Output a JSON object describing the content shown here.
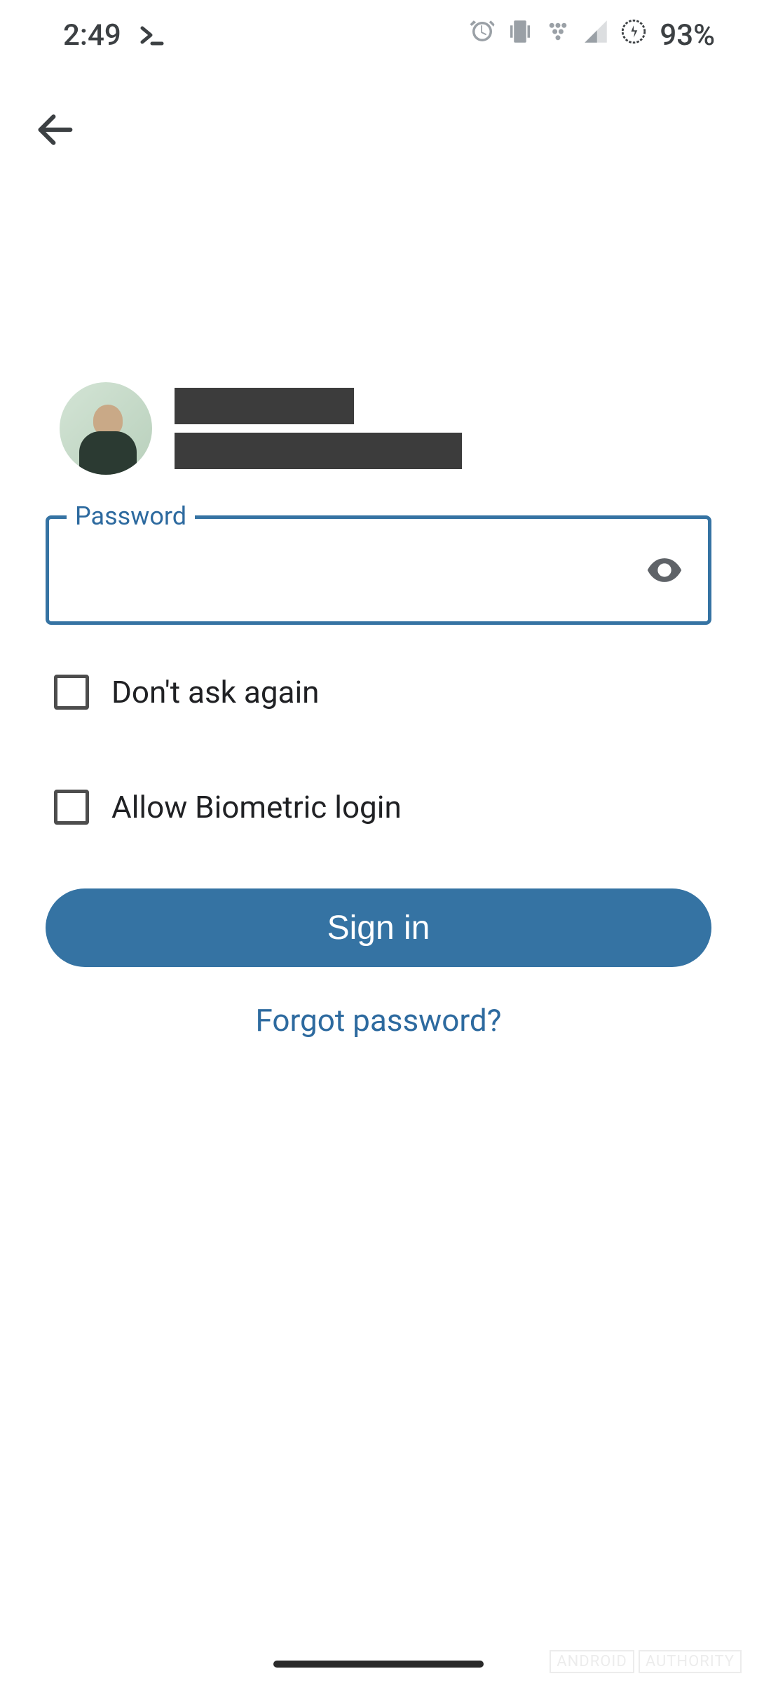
{
  "status": {
    "time": "2:49",
    "battery_pct": "93%"
  },
  "form": {
    "password_label": "Password",
    "password_value": "",
    "dont_ask_label": "Don't ask again",
    "biometric_label": "Allow Biometric login",
    "signin_label": "Sign in",
    "forgot_label": "Forgot password?"
  },
  "watermark": {
    "brand1": "ANDROID",
    "brand2": "AUTHORITY"
  },
  "colors": {
    "accent": "#3573a3",
    "text": "#202124",
    "muted": "#5f6368"
  }
}
